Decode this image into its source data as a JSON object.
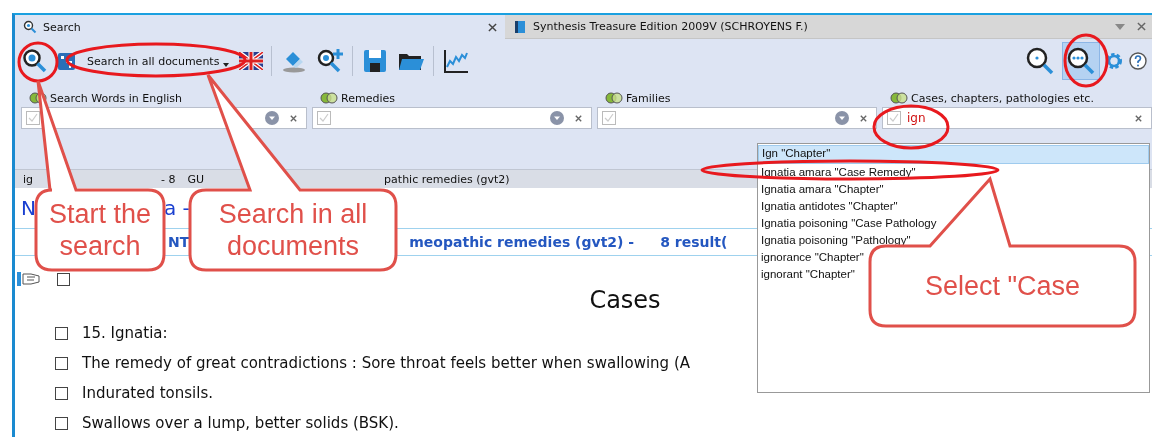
{
  "tabs": [
    {
      "label": "Search",
      "selected": true
    },
    {
      "label": "Synthesis Treasure Edition 2009V (SCHROYENS F.)",
      "selected": false
    }
  ],
  "toolbar": {
    "search_scope": "Search in all documents"
  },
  "search_modes": [
    {
      "selected": false
    },
    {
      "selected": true
    }
  ],
  "fields": [
    {
      "label": "Search Words in English",
      "has_dropdown": true
    },
    {
      "label": "Remedies",
      "has_dropdown": true
    },
    {
      "label": "Families",
      "has_dropdown": true
    },
    {
      "label": "Cases, chapters, pathologies etc.",
      "has_dropdown": false,
      "value": "ign"
    }
  ],
  "info_bar": [
    "ig",
    "- 8",
    "GU",
    "pathic remedies (gvt2)"
  ],
  "title_fragments": [
    "N",
    "a -"
  ],
  "heading_fragments": [
    "NT",
    "meopathic remedies (gvt2) -",
    "8 result("
  ],
  "document": {
    "top_checkbox": {
      "checked": false
    },
    "heading": "Cases",
    "items": [
      {
        "text": "15. Ignatia:",
        "checked": false
      },
      {
        "text": "The remedy of great contradictions : Sore throat feels better when swallowing (A",
        "checked": false
      },
      {
        "text": "Indurated tonsils.",
        "checked": false
      },
      {
        "text": "Swallows over a lump, better solids (BSK).",
        "checked": false
      }
    ]
  },
  "suggestions": [
    {
      "label": "Ign \"Chapter\"",
      "selected": true
    },
    {
      "label": "Ignatia amara \"Case Remedy\"",
      "selected": false
    },
    {
      "label": "Ignatia amara \"Chapter\"",
      "selected": false
    },
    {
      "label": "Ignatia antidotes \"Chapter\"",
      "selected": false
    },
    {
      "label": "Ignatia poisoning \"Case Pathology",
      "selected": false
    },
    {
      "label": "Ignatia poisoning \"Pathology\"",
      "selected": false
    },
    {
      "label": "ignorance \"Chapter\"",
      "selected": false
    },
    {
      "label": "ignorant \"Chapter\"",
      "selected": false
    }
  ],
  "callouts": [
    {
      "text": "Start the search"
    },
    {
      "text": "Search in all documents"
    },
    {
      "text": "Select \"Case"
    }
  ]
}
